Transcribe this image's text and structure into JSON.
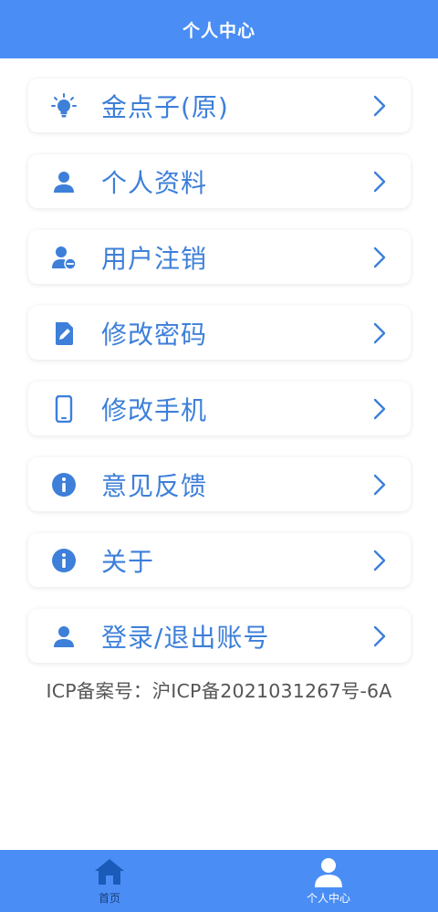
{
  "header": {
    "title": "个人中心"
  },
  "menu": {
    "items": [
      {
        "label": "金点子(原)",
        "icon": "lightbulb-icon"
      },
      {
        "label": "个人资料",
        "icon": "user-icon"
      },
      {
        "label": "用户注销",
        "icon": "user-remove-icon"
      },
      {
        "label": "修改密码",
        "icon": "edit-document-icon"
      },
      {
        "label": "修改手机",
        "icon": "phone-icon"
      },
      {
        "label": "意见反馈",
        "icon": "info-icon"
      },
      {
        "label": "关于",
        "icon": "info-icon"
      },
      {
        "label": "登录/退出账号",
        "icon": "user-icon"
      }
    ]
  },
  "icp": {
    "text": "ICP备案号：沪ICP备2021031267号-6A"
  },
  "tabbar": {
    "tabs": [
      {
        "label": "首页",
        "icon": "home-icon"
      },
      {
        "label": "个人中心",
        "icon": "user-icon"
      }
    ]
  },
  "colors": {
    "primary": "#4a8ef5",
    "text_accent": "#3d7fd9",
    "icon": "#3d7fd9",
    "active_tab": "#1a3d7a"
  }
}
